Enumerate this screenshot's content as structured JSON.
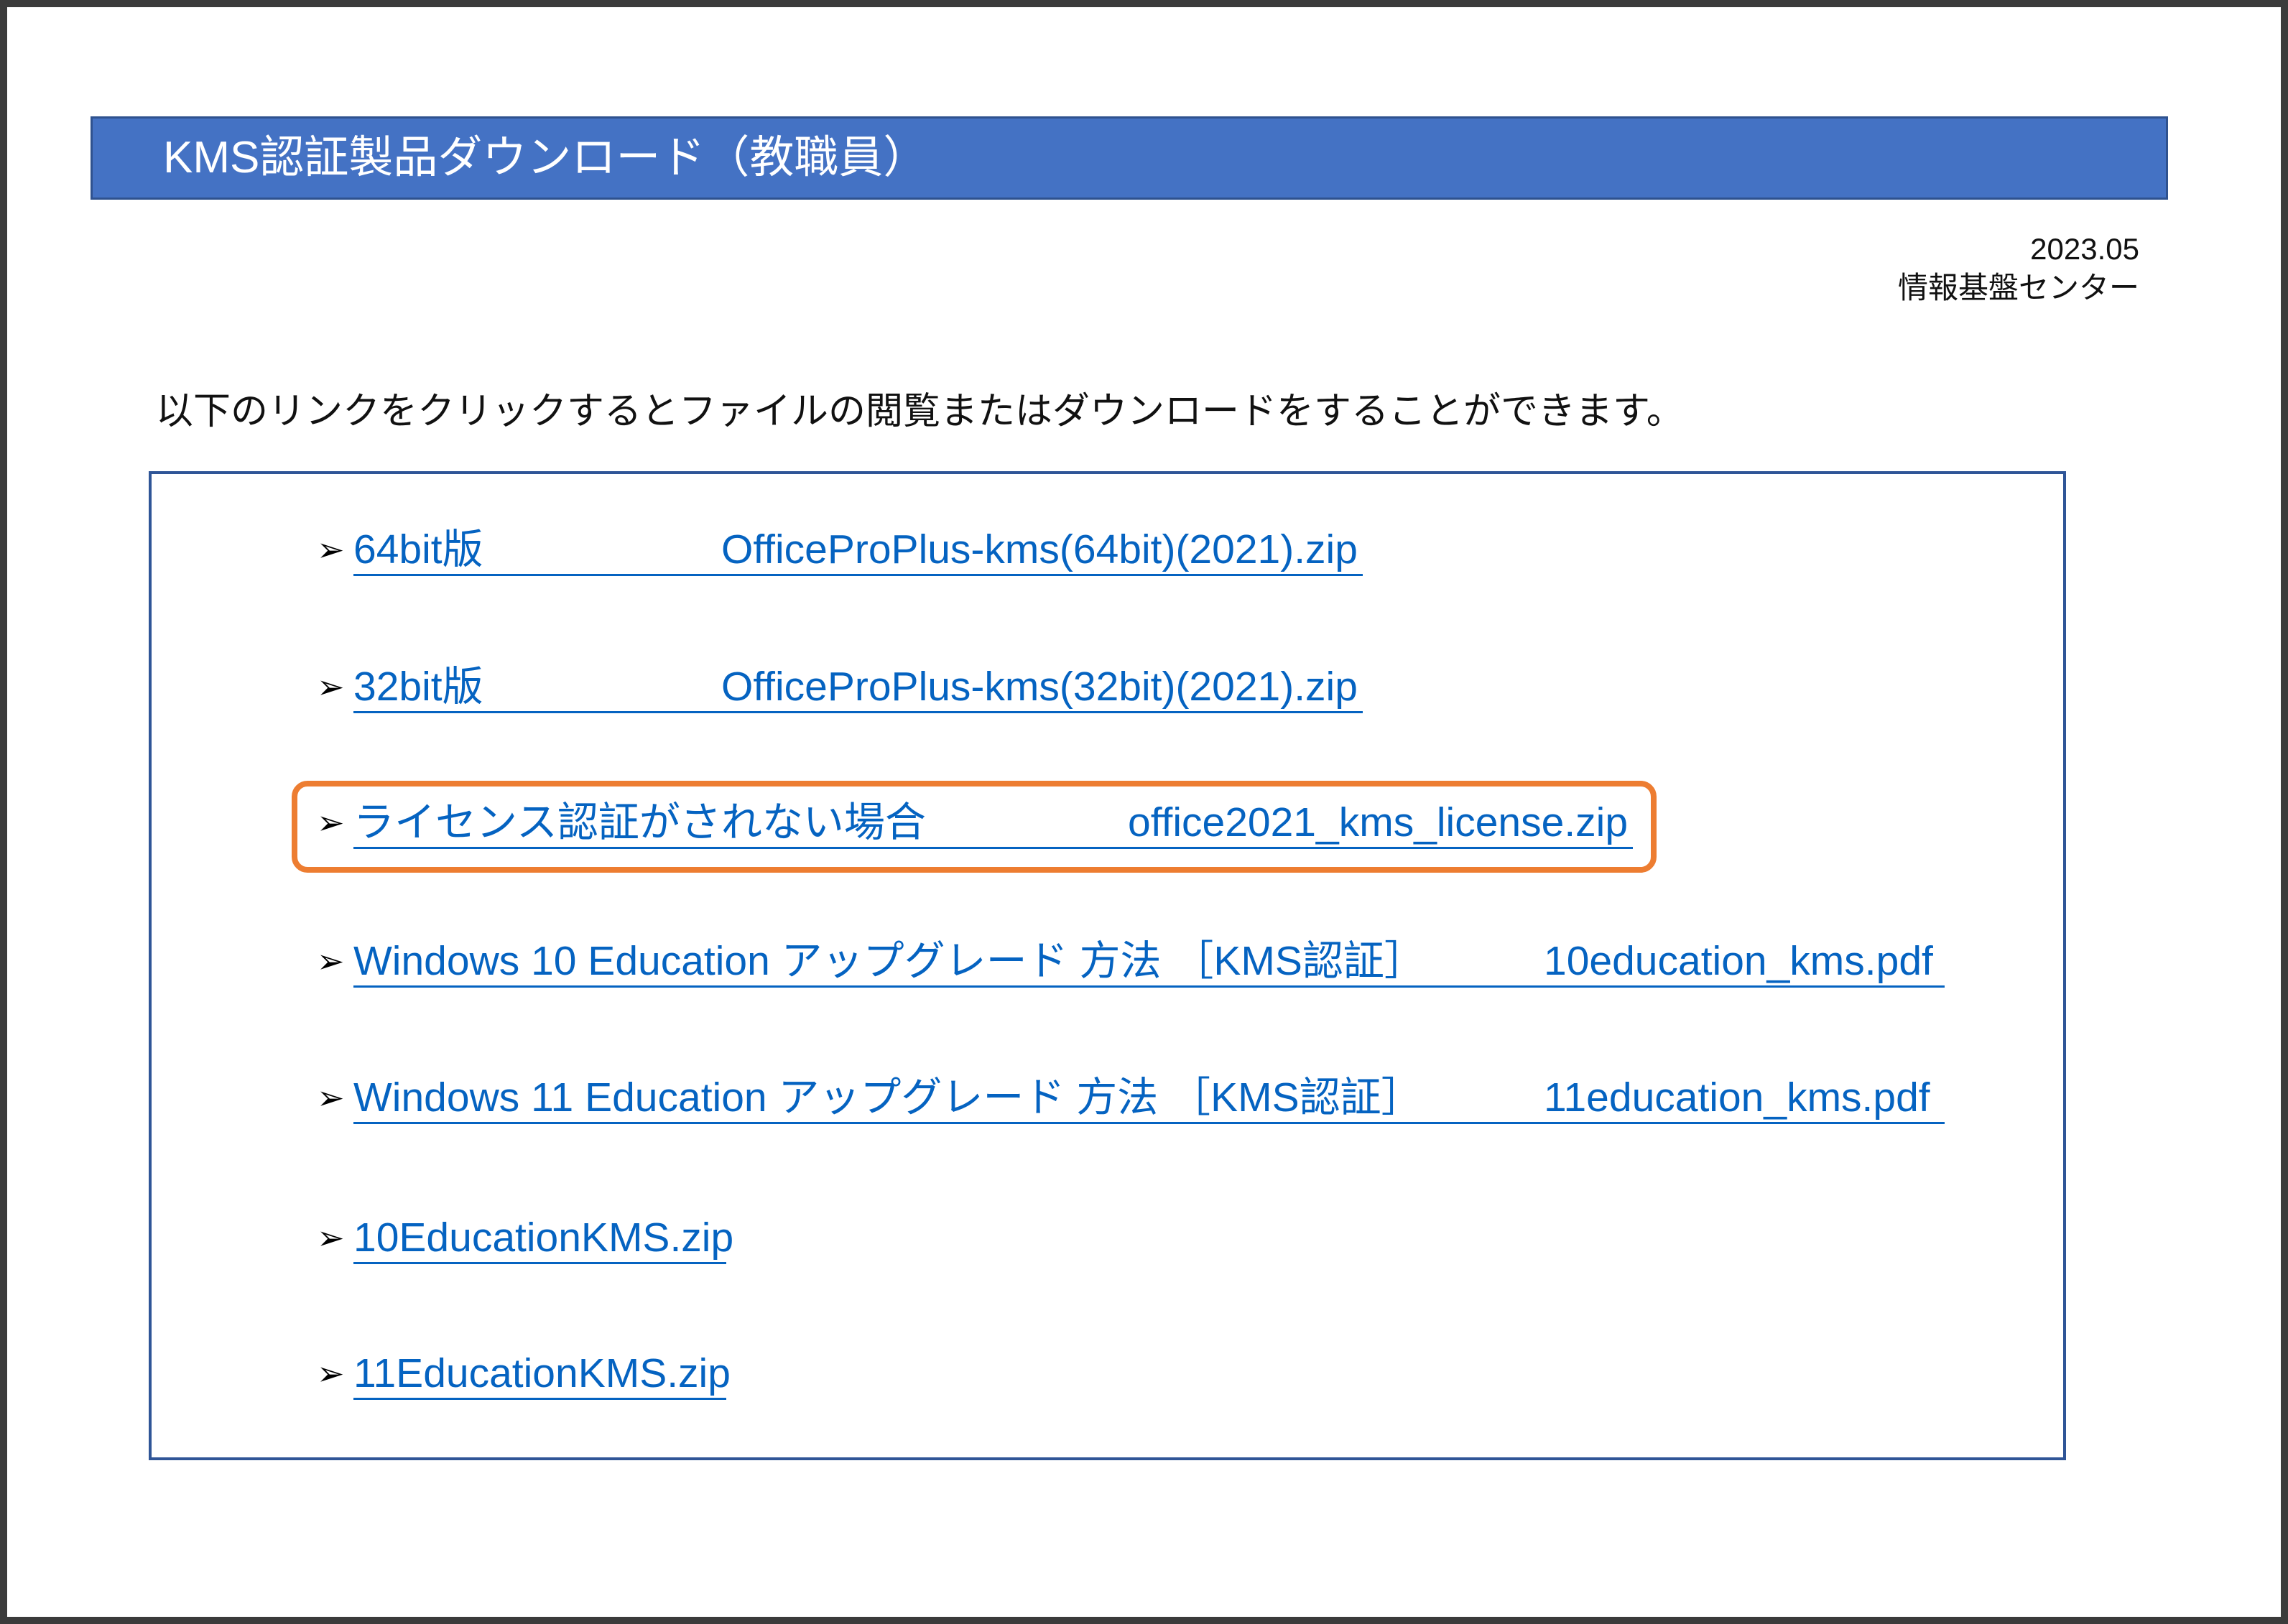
{
  "header": {
    "title": "KMS認証製品ダウンロード（教職員）"
  },
  "meta": {
    "date": "2023.05",
    "org": "情報基盤センター"
  },
  "intro": "以下のリンクをクリックするとファイルの閲覧またはダウンロードをすることができます。",
  "bullet": "➢",
  "bullet_icon": "arrow-bullet-icon",
  "links": [
    {
      "label": "64bit版",
      "file": "OfficeProPlus-kms(64bit)(2021).zip"
    },
    {
      "label": "32bit版",
      "file": "OfficeProPlus-kms(32bit)(2021).zip"
    },
    {
      "label": "ライセンス認証がされない場合",
      "file": "office2021_kms_license.zip",
      "highlighted": true
    },
    {
      "label": "Windows 10 Education アップグレード 方法 ［KMS認証］",
      "file": "10education_kms.pdf"
    },
    {
      "label": "Windows 11 Education アップグレード 方法 ［KMS認証］",
      "file": "11education_kms.pdf"
    },
    {
      "label": "10EducationKMS.zip"
    },
    {
      "label": "11EducationKMS.zip"
    }
  ],
  "colors": {
    "header_bg": "#4472C4",
    "link": "#0563C1",
    "highlight": "#ED7D31",
    "box_border": "#2F5597"
  }
}
